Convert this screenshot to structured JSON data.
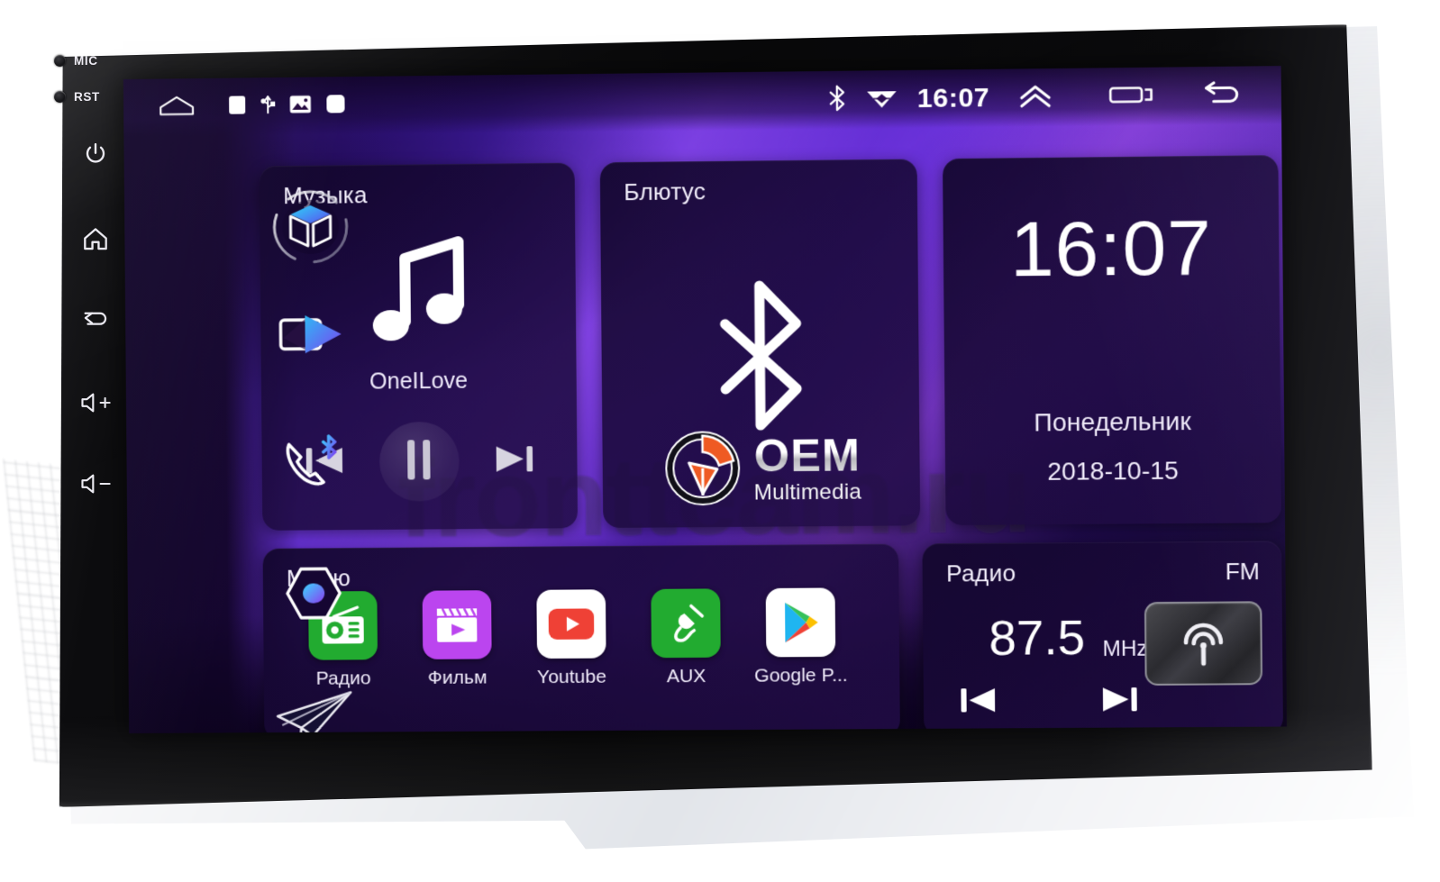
{
  "device": {
    "hard_keys": [
      {
        "name": "mic-indicator",
        "label": "MIC",
        "type": "led"
      },
      {
        "name": "reset-indicator",
        "label": "RST",
        "type": "led"
      },
      {
        "name": "power-key",
        "label": "",
        "icon": "power-icon"
      },
      {
        "name": "home-key",
        "label": "",
        "icon": "home-icon"
      },
      {
        "name": "back-key",
        "label": "",
        "icon": "back-arrow-icon"
      },
      {
        "name": "volume-up-key",
        "label": "",
        "icon": "volume-up-icon"
      },
      {
        "name": "volume-down-key",
        "label": "",
        "icon": "volume-down-icon"
      }
    ]
  },
  "statusbar": {
    "left_icons": [
      "home-outline-icon",
      "sd-card-icon",
      "usb-icon",
      "photo-icon",
      "app-square-icon"
    ],
    "bluetooth_icon": "bluetooth-icon",
    "wifi_icon": "wifi-icon",
    "clock": "16:07",
    "expand_icon": "chevron-up-double-icon",
    "recents_icon": "recents-icon",
    "back_icon": "back-arrow-icon"
  },
  "rail": {
    "items": [
      {
        "name": "apps-cube-icon",
        "label": "Apps"
      },
      {
        "name": "video-play-icon",
        "label": "Video"
      },
      {
        "name": "bluetooth-phone-icon",
        "label": "Bluetooth phone"
      },
      {
        "name": "hexagon-settings-icon",
        "label": "Settings"
      },
      {
        "name": "navigation-paperplane-icon",
        "label": "Navigation"
      }
    ]
  },
  "music": {
    "title": "Музыка",
    "track": "OneILove",
    "icon": "music-note-icon",
    "prev_icon": "skip-previous-icon",
    "play_state_icon": "pause-icon",
    "next_icon": "skip-next-icon"
  },
  "bluetooth": {
    "title": "Блютус",
    "icon": "bluetooth-icon",
    "brand_main": "OEM",
    "brand_sub": "Multimedia",
    "brand_mark_icon": "oem-compass-icon",
    "brand_accent": "#ef5a23"
  },
  "clock_card": {
    "time": "16:07",
    "weekday": "Понедельник",
    "date": "2018-10-15"
  },
  "menu": {
    "title": "Меню",
    "apps": [
      {
        "label": "Радио",
        "icon": "radio-icon",
        "bg": "#22ab30"
      },
      {
        "label": "Фильм",
        "icon": "movie-clapper-icon",
        "bg": "#bb45ef"
      },
      {
        "label": "Youtube",
        "icon": "youtube-icon",
        "bg": "#ffffff"
      },
      {
        "label": "AUX",
        "icon": "aux-cable-icon",
        "bg": "#22ab30"
      },
      {
        "label": "Google P...",
        "icon": "google-play-icon",
        "bg": "#ffffff"
      }
    ]
  },
  "radio": {
    "title": "Радио",
    "band": "FM",
    "frequency": "87.5",
    "unit": "MHz",
    "prev_icon": "skip-previous-icon",
    "next_icon": "skip-next-icon",
    "antenna_icon": "radio-antenna-icon"
  },
  "watermark": {
    "text": "frontteam.ru"
  },
  "colors": {
    "wallpaper_purple": "#6c34e0",
    "wallpaper_dark": "#140730",
    "card_bg": "#1a093a",
    "accent_green": "#22ab30",
    "accent_purple": "#bb45ef",
    "accent_red": "#ef4136",
    "accent_orange": "#ef5a23"
  }
}
